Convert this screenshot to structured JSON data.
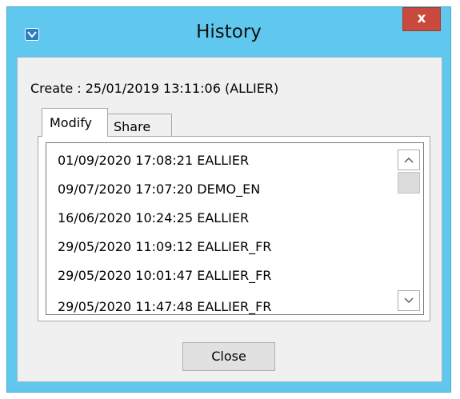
{
  "window": {
    "title": "History",
    "close_glyph": "x",
    "app_icon": "app-icon",
    "colors": {
      "frame": "#60c8ee",
      "close_button": "#c94a3d",
      "client_bg": "#f0f0f0"
    }
  },
  "create_label": "Create : 25/01/2019 13:11:06 (ALLIER)",
  "tabs": [
    {
      "label": "Modify",
      "selected": true
    },
    {
      "label": "Share",
      "selected": false
    }
  ],
  "history_list": {
    "items": [
      "01/09/2020 17:08:21 EALLIER",
      "09/07/2020 17:07:20 DEMO_EN",
      "16/06/2020 10:24:25 EALLIER",
      "29/05/2020 11:09:12 EALLIER_FR",
      "29/05/2020 10:01:47 EALLIER_FR",
      "29/05/2020 11:47:48 EALLIER_FR"
    ],
    "scroll_up_icon": "chevron-up-icon",
    "scroll_down_icon": "chevron-down-icon"
  },
  "close_button_label": "Close"
}
